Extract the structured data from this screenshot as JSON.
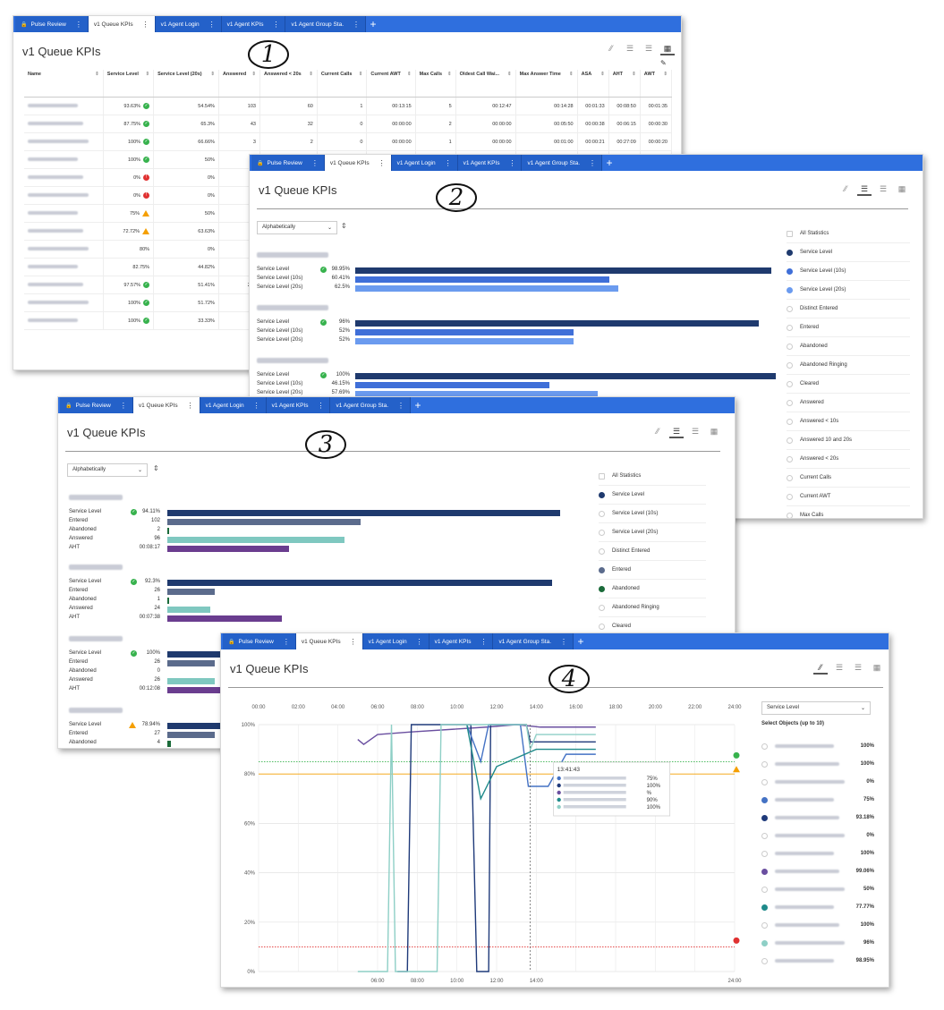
{
  "tabs": [
    "Pulse Review",
    "v1 Queue KPIs",
    "v1 Agent Login",
    "v1 Agent KPIs",
    "v1 Agent Group Sta."
  ],
  "page_title": "v1 Queue KPIs",
  "callouts": [
    "1",
    "2",
    "3",
    "4"
  ],
  "table": {
    "headers": [
      "Name",
      "Service Level",
      "Service Level (20s)",
      "Answered",
      "Answered < 20s",
      "Current Calls",
      "Current AWT",
      "Max Calls",
      "Oldest Call Wai...",
      "Max Answer Time",
      "ASA",
      "AHT",
      "AWT"
    ],
    "rows": [
      {
        "sl": "93.63%",
        "st": "ok",
        "sl20": "54.54%",
        "ans": "103",
        "a20": "60",
        "cc": "1",
        "awt": "00:13:15",
        "mc": "5",
        "oldest": "00:12:47",
        "mat": "00:14:28",
        "asa": "00:01:33",
        "aht": "00:08:50",
        "awt2": "00:01:35"
      },
      {
        "sl": "87.75%",
        "st": "ok",
        "sl20": "65.3%",
        "ans": "43",
        "a20": "32",
        "cc": "0",
        "awt": "00:00:00",
        "mc": "2",
        "oldest": "00:00:00",
        "mat": "00:05:50",
        "asa": "00:00:38",
        "aht": "00:06:15",
        "awt2": "00:00:30"
      },
      {
        "sl": "100%",
        "st": "ok",
        "sl20": "66.66%",
        "ans": "3",
        "a20": "2",
        "cc": "0",
        "awt": "00:00:00",
        "mc": "1",
        "oldest": "00:00:00",
        "mat": "00:01:00",
        "asa": "00:00:21",
        "aht": "00:27:09",
        "awt2": "00:00:20"
      },
      {
        "sl": "100%",
        "st": "ok",
        "sl20": "50%",
        "ans": "2"
      },
      {
        "sl": "0%",
        "st": "err",
        "sl20": "0%",
        "ans": "0"
      },
      {
        "sl": "0%",
        "st": "err",
        "sl20": "0%",
        "ans": "0"
      },
      {
        "sl": "75%",
        "st": "warn",
        "sl20": "50%",
        "ans": "3"
      },
      {
        "sl": "72.72%",
        "st": "warn",
        "sl20": "63.63%",
        "ans": "16"
      },
      {
        "sl": "80%",
        "st": "",
        "sl20": "0%",
        "ans": "4"
      },
      {
        "sl": "82.75%",
        "st": "",
        "sl20": "44.82%",
        "ans": "24"
      },
      {
        "sl": "97.57%",
        "st": "ok",
        "sl20": "51.41%",
        "ans": "241"
      },
      {
        "sl": "100%",
        "st": "ok",
        "sl20": "51.72%",
        "ans": "29"
      },
      {
        "sl": "100%",
        "st": "ok",
        "sl20": "33.33%",
        "ans": "3"
      }
    ]
  },
  "sort": {
    "label": "Alphabetically"
  },
  "panel2_groups": [
    {
      "rows": [
        {
          "label": "Service Level",
          "value": "98.95%",
          "pct": 98.95,
          "ok": true
        },
        {
          "label": "Service Level (10s)",
          "value": "60.41%",
          "pct": 60.41
        },
        {
          "label": "Service Level (20s)",
          "value": "62.5%",
          "pct": 62.5
        }
      ]
    },
    {
      "rows": [
        {
          "label": "Service Level",
          "value": "96%",
          "pct": 96,
          "ok": true
        },
        {
          "label": "Service Level (10s)",
          "value": "52%",
          "pct": 52
        },
        {
          "label": "Service Level (20s)",
          "value": "52%",
          "pct": 52
        }
      ]
    },
    {
      "rows": [
        {
          "label": "Service Level",
          "value": "100%",
          "pct": 100,
          "ok": true
        },
        {
          "label": "Service Level (10s)",
          "value": "46.15%",
          "pct": 46.15
        },
        {
          "label": "Service Level (20s)",
          "value": "57.69%",
          "pct": 57.69
        }
      ]
    }
  ],
  "panel2_legend": [
    "All Statistics",
    "Service Level",
    "Service Level (10s)",
    "Service Level (20s)",
    "Distinct Entered",
    "Entered",
    "Abandoned",
    "Abandoned Ringing",
    "Cleared",
    "Answered",
    "Answered < 10s",
    "Answered 10 and 20s",
    "Answered < 20s",
    "Current Calls",
    "Current AWT",
    "Max Calls"
  ],
  "panel3_groups": [
    {
      "rows": [
        {
          "label": "Service Level",
          "value": "94.11%",
          "rel": 94.11,
          "ok": true
        },
        {
          "label": "Entered",
          "value": "102",
          "rel": 0.49
        },
        {
          "label": "Abandoned",
          "value": "2",
          "rel": 0.005
        },
        {
          "label": "Answered",
          "value": "96",
          "rel": 0.45
        },
        {
          "label": "AHT",
          "value": "00:08:17",
          "rel": 0.31
        }
      ]
    },
    {
      "rows": [
        {
          "label": "Service Level",
          "value": "92.3%",
          "rel": 92.3,
          "ok": true
        },
        {
          "label": "Entered",
          "value": "26",
          "rel": 0.12
        },
        {
          "label": "Abandoned",
          "value": "1",
          "rel": 0.002
        },
        {
          "label": "Answered",
          "value": "24",
          "rel": 0.11
        },
        {
          "label": "AHT",
          "value": "00:07:38",
          "rel": 0.29
        }
      ]
    },
    {
      "rows": [
        {
          "label": "Service Level",
          "value": "100%",
          "rel": 100,
          "ok": true
        },
        {
          "label": "Entered",
          "value": "26",
          "rel": 0.12
        },
        {
          "label": "Abandoned",
          "value": "0",
          "rel": 0
        },
        {
          "label": "Answered",
          "value": "26",
          "rel": 0.12
        },
        {
          "label": "AHT",
          "value": "00:12:08",
          "rel": 0.36
        }
      ]
    },
    {
      "rows": [
        {
          "label": "Service Level",
          "value": "78.94%",
          "rel": 78.94,
          "warn": true
        },
        {
          "label": "Entered",
          "value": "27",
          "rel": 0.12
        },
        {
          "label": "Abandoned",
          "value": "4",
          "rel": 0.01
        }
      ]
    }
  ],
  "panel3_legend": [
    "All Statistics",
    "Service Level",
    "Service Level (10s)",
    "Service Level (20s)",
    "Distinct Entered",
    "Entered",
    "Abandoned",
    "Abandoned Ringing",
    "Cleared"
  ],
  "panel4": {
    "dropdown": "Service Level",
    "select_label": "Select Objects (up to 10)",
    "objects": [
      {
        "value": "100%",
        "color": ""
      },
      {
        "value": "100%",
        "color": ""
      },
      {
        "value": "0%",
        "color": ""
      },
      {
        "value": "75%",
        "color": "#4472c4"
      },
      {
        "value": "93.18%",
        "color": "#1f3a7a"
      },
      {
        "value": "0%",
        "color": ""
      },
      {
        "value": "100%",
        "color": ""
      },
      {
        "value": "99.06%",
        "color": "#6a4fa0"
      },
      {
        "value": "50%",
        "color": ""
      },
      {
        "value": "77.77%",
        "color": "#1f8a8a"
      },
      {
        "value": "100%",
        "color": ""
      },
      {
        "value": "96%",
        "color": "#8ecfc6"
      },
      {
        "value": "98.95%",
        "color": ""
      }
    ],
    "tooltip": {
      "time": "13:41:43",
      "values": [
        "75%",
        "100%",
        "%",
        "90%",
        "100%"
      ]
    }
  },
  "chart_data": [
    {
      "type": "bar",
      "categories": [
        "Service Level",
        "Service Level (10s)",
        "Service Level (20s)"
      ],
      "series": [
        {
          "values": [
            98.95,
            60.41,
            62.5
          ]
        },
        {
          "values": [
            96,
            52,
            52
          ]
        },
        {
          "values": [
            100,
            46.15,
            57.69
          ]
        }
      ]
    },
    {
      "type": "bar",
      "categories": [
        "Service Level",
        "Entered",
        "Abandoned",
        "Answered",
        "AHT"
      ],
      "series": [
        {
          "values": [
            94.11,
            102,
            2,
            96,
            "00:08:17"
          ]
        },
        {
          "values": [
            92.3,
            26,
            1,
            24,
            "00:07:38"
          ]
        },
        {
          "values": [
            100,
            26,
            0,
            26,
            "00:12:08"
          ]
        },
        {
          "values": [
            78.94,
            27,
            4
          ]
        }
      ]
    },
    {
      "type": "line",
      "x_ticks_top": [
        "00:00",
        "02:00",
        "04:00",
        "06:00",
        "08:00",
        "10:00",
        "12:00",
        "14:00",
        "16:00",
        "18:00",
        "20:00",
        "22:00",
        "24:00"
      ],
      "x_ticks_bottom": [
        "06:00",
        "08:00",
        "10:00",
        "12:00",
        "14:00",
        "24:00"
      ],
      "y_ticks": [
        "0%",
        "20%",
        "40%",
        "60%",
        "80%",
        "100%"
      ],
      "ylim": [
        0,
        100
      ],
      "xlim": [
        0,
        24
      ],
      "thresholds": [
        {
          "y": 85,
          "color": "#37b24d"
        },
        {
          "y": 80,
          "color": "#f59f00"
        },
        {
          "y": 10,
          "color": "#e03131"
        }
      ],
      "series": [
        {
          "color": "#6a4fa0",
          "points": [
            [
              5,
              94
            ],
            [
              5.3,
              92
            ],
            [
              6,
              96
            ],
            [
              7.6,
              97
            ],
            [
              11.5,
              99
            ],
            [
              13,
              100
            ],
            [
              14.2,
              99
            ],
            [
              16,
              99
            ],
            [
              17,
              99
            ]
          ]
        },
        {
          "color": "#1f3a7a",
          "points": [
            [
              7,
              0
            ],
            [
              7.5,
              0
            ],
            [
              7.7,
              100
            ],
            [
              10.7,
              100
            ],
            [
              11,
              0
            ],
            [
              11.6,
              0
            ],
            [
              11.7,
              100
            ],
            [
              13.5,
              100
            ],
            [
              13.7,
              93
            ],
            [
              17,
              93
            ]
          ]
        },
        {
          "color": "#4472c4",
          "points": [
            [
              10.5,
              100
            ],
            [
              11.2,
              85
            ],
            [
              11.6,
              100
            ],
            [
              13.2,
              100
            ],
            [
              13.6,
              75
            ],
            [
              14.6,
              75
            ],
            [
              15.5,
              88
            ],
            [
              17,
              88
            ]
          ]
        },
        {
          "color": "#1f8a8a",
          "points": [
            [
              10.5,
              100
            ],
            [
              11.2,
              70
            ],
            [
              12,
              83
            ],
            [
              14,
              90
            ],
            [
              15,
              90
            ],
            [
              16,
              90
            ],
            [
              17,
              90
            ]
          ]
        },
        {
          "color": "#8ecfc6",
          "points": [
            [
              5,
              0
            ],
            [
              6.5,
              0
            ],
            [
              6.7,
              100
            ],
            [
              6.9,
              0
            ],
            [
              9,
              0
            ],
            [
              9.2,
              100
            ],
            [
              13.5,
              100
            ],
            [
              13.7,
              90
            ],
            [
              14,
              96
            ],
            [
              17,
              96
            ]
          ]
        }
      ]
    }
  ]
}
